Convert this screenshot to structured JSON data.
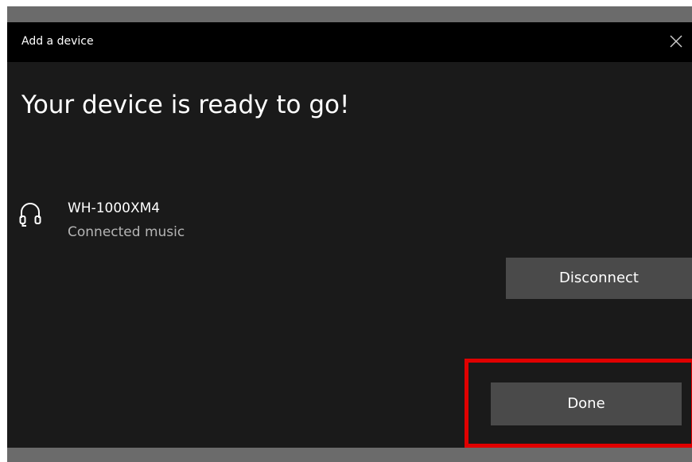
{
  "window": {
    "title": "Add a device",
    "close_glyph": "×"
  },
  "main": {
    "heading": "Your device is ready to go!"
  },
  "device": {
    "icon": "headphones-icon",
    "name": "WH-1000XM4",
    "status": "Connected music"
  },
  "buttons": {
    "disconnect_label": "Disconnect",
    "done_label": "Done"
  },
  "colors": {
    "dialog_bg": "#1a1a1a",
    "title_bar_bg": "#000000",
    "button_bg": "#4a4a4a",
    "highlight": "#e00000"
  }
}
